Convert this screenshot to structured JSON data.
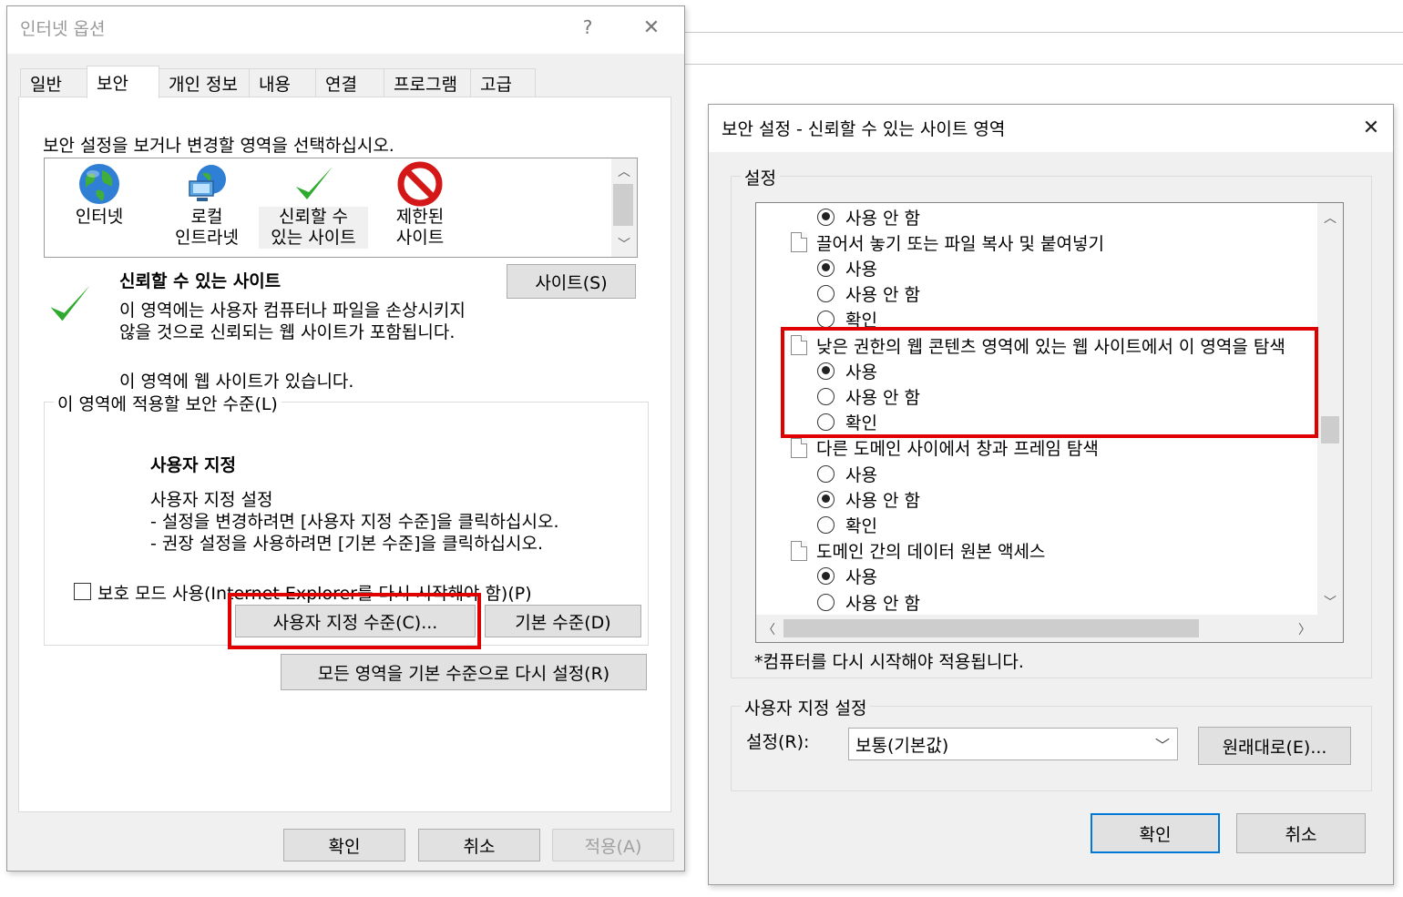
{
  "internet_options": {
    "title": "인터넷 옵션",
    "help_glyph": "?",
    "close_glyph": "✕",
    "tabs": [
      {
        "label": "일반"
      },
      {
        "label": "보안"
      },
      {
        "label": "개인 정보"
      },
      {
        "label": "내용"
      },
      {
        "label": "연결"
      },
      {
        "label": "프로그램"
      },
      {
        "label": "고급"
      }
    ],
    "instruction": "보안 설정을 보거나 변경할 영역을 선택하십시오.",
    "zones": [
      {
        "line1": "인터넷",
        "line2": "",
        "icon": "globe-icon"
      },
      {
        "line1": "로컬",
        "line2": "인트라넷",
        "icon": "intranet-icon"
      },
      {
        "line1": "신뢰할 수",
        "line2": "있는 사이트",
        "icon": "checkmark-icon"
      },
      {
        "line1": "제한된",
        "line2": "사이트",
        "icon": "restricted-icon"
      }
    ],
    "zone_heading": "신뢰할 수 있는 사이트",
    "zone_desc_1": "이 영역에는 사용자 컴퓨터나 파일을 손상시키지",
    "zone_desc_2": "않을 것으로 신뢰되는 웹 사이트가 포함됩니다.",
    "zone_status": "이 영역에 웹 사이트가 있습니다.",
    "sites_button": "사이트(S)",
    "level_group_title": "이 영역에 적용할 보안 수준(L)",
    "level_heading": "사용자 지정",
    "level_line1": "사용자 지정 설정",
    "level_line2": "- 설정을 변경하려면 [사용자 지정 수준]을 클릭하십시오.",
    "level_line3": "- 권장 설정을 사용하려면 [기본 수준]을 클릭하십시오.",
    "protected_mode": "보호 모드 사용(Internet Explorer를 다시 시작해야 함)(P)",
    "custom_level_button": "사용자 지정 수준(C)...",
    "default_level_button": "기본 수준(D)",
    "reset_all_button": "모든 영역을 기본 수준으로 다시 설정(R)",
    "ok_button": "확인",
    "cancel_button": "취소",
    "apply_button": "적용(A)"
  },
  "security_settings": {
    "title": "보안 설정 - 신뢰할 수 있는 사이트 영역",
    "close_glyph": "✕",
    "settings_group_title": "설정",
    "tree": [
      {
        "kind": "radio",
        "label": "사용 안 함",
        "checked": true
      },
      {
        "kind": "item",
        "label": "끌어서 놓기 또는 파일 복사 및 붙여넣기"
      },
      {
        "kind": "radio",
        "label": "사용",
        "checked": true
      },
      {
        "kind": "radio",
        "label": "사용 안 함",
        "checked": false
      },
      {
        "kind": "radio",
        "label": "확인",
        "checked": false
      },
      {
        "kind": "item",
        "label": "낮은 권한의 웹 콘텐츠 영역에 있는 웹 사이트에서 이 영역을 탐색"
      },
      {
        "kind": "radio",
        "label": "사용",
        "checked": true
      },
      {
        "kind": "radio",
        "label": "사용 안 함",
        "checked": false
      },
      {
        "kind": "radio",
        "label": "확인",
        "checked": false
      },
      {
        "kind": "item",
        "label": "다른 도메인 사이에서 창과 프레임 탐색"
      },
      {
        "kind": "radio",
        "label": "사용",
        "checked": false
      },
      {
        "kind": "radio",
        "label": "사용 안 함",
        "checked": true
      },
      {
        "kind": "radio",
        "label": "확인",
        "checked": false
      },
      {
        "kind": "item",
        "label": "도메인 간의 데이터 원본 액세스"
      },
      {
        "kind": "radio",
        "label": "사용",
        "checked": true
      },
      {
        "kind": "radio",
        "label": "사용 안 함",
        "checked": false
      }
    ],
    "restart_note": "*컴퓨터를 다시 시작해야 적용됩니다.",
    "custom_group_title": "사용자 지정 설정",
    "settings_label": "설정(R):",
    "settings_value": "보통(기본값)",
    "reset_button": "원래대로(E)...",
    "ok_button": "확인",
    "cancel_button": "취소"
  },
  "colors": {
    "highlight_red": "#e00000",
    "default_button_border": "#0078d7"
  }
}
